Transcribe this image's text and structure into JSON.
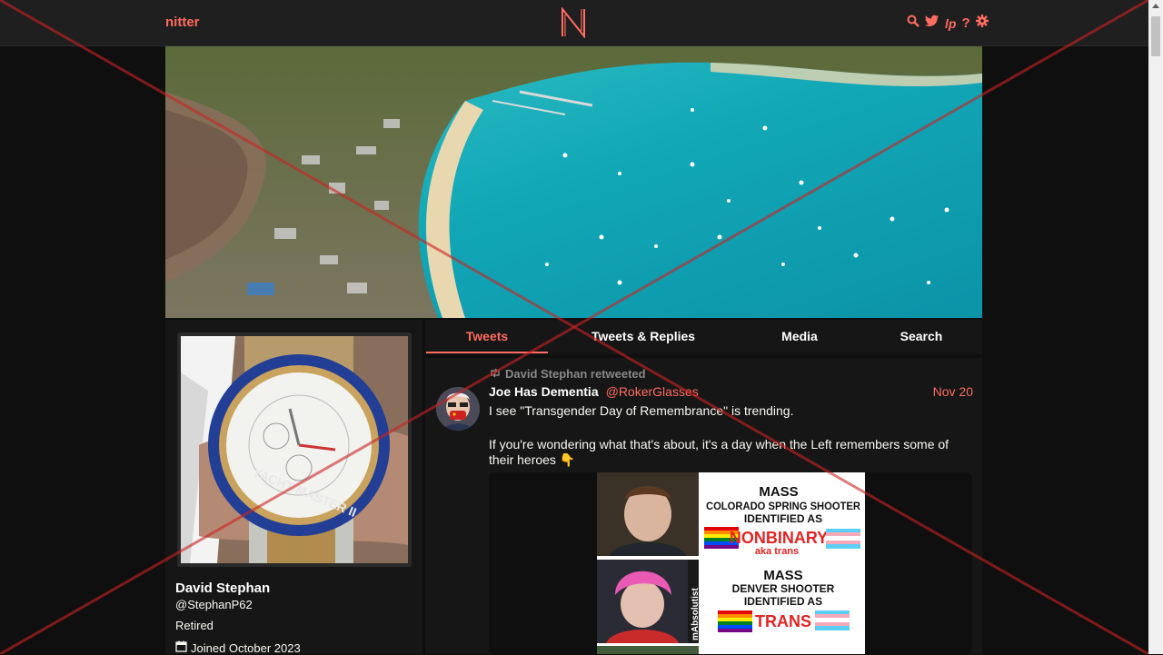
{
  "nav": {
    "brand": "nitter",
    "icons": [
      "search-icon",
      "twitter-icon",
      "rss-icon",
      "help-icon",
      "settings-icon"
    ]
  },
  "profile": {
    "fullname": "David Stephan",
    "username": "@StephanP62",
    "bio": "Retired",
    "joined": "Joined October 2023"
  },
  "tabs": [
    {
      "label": "Tweets",
      "active": true
    },
    {
      "label": "Tweets & Replies",
      "active": false
    },
    {
      "label": "Media",
      "active": false
    },
    {
      "label": "Search",
      "active": false
    }
  ],
  "tweet": {
    "retweet_text": "David Stephan retweeted",
    "fullname": "Joe Has Dementia",
    "username": "@RokerGlasses",
    "date": "Nov 20",
    "body_line1": "I see \"Transgender Day of Remembrance\" is trending.",
    "body_line2": "If you're wondering what that's about, it's a day when the Left remembers some of their heroes 👇",
    "media_texts": {
      "top_line1": "MASS",
      "top_line2": "COLORADO SPRING SHOOTER",
      "top_line3": "IDENTIFIED AS",
      "top_highlight": "NONBINARY",
      "top_sub": "aka trans",
      "bottom_line1": "MASS",
      "bottom_line2": "DENVER SHOOTER",
      "bottom_line3": "IDENTIFIED AS",
      "bottom_highlight": "TRANS",
      "side_text": "mAbsolutist"
    }
  },
  "colors": {
    "accent": "#ff6c60",
    "background": "#0f0f0f",
    "panel": "#161616",
    "navbar": "#1f1f1f"
  }
}
